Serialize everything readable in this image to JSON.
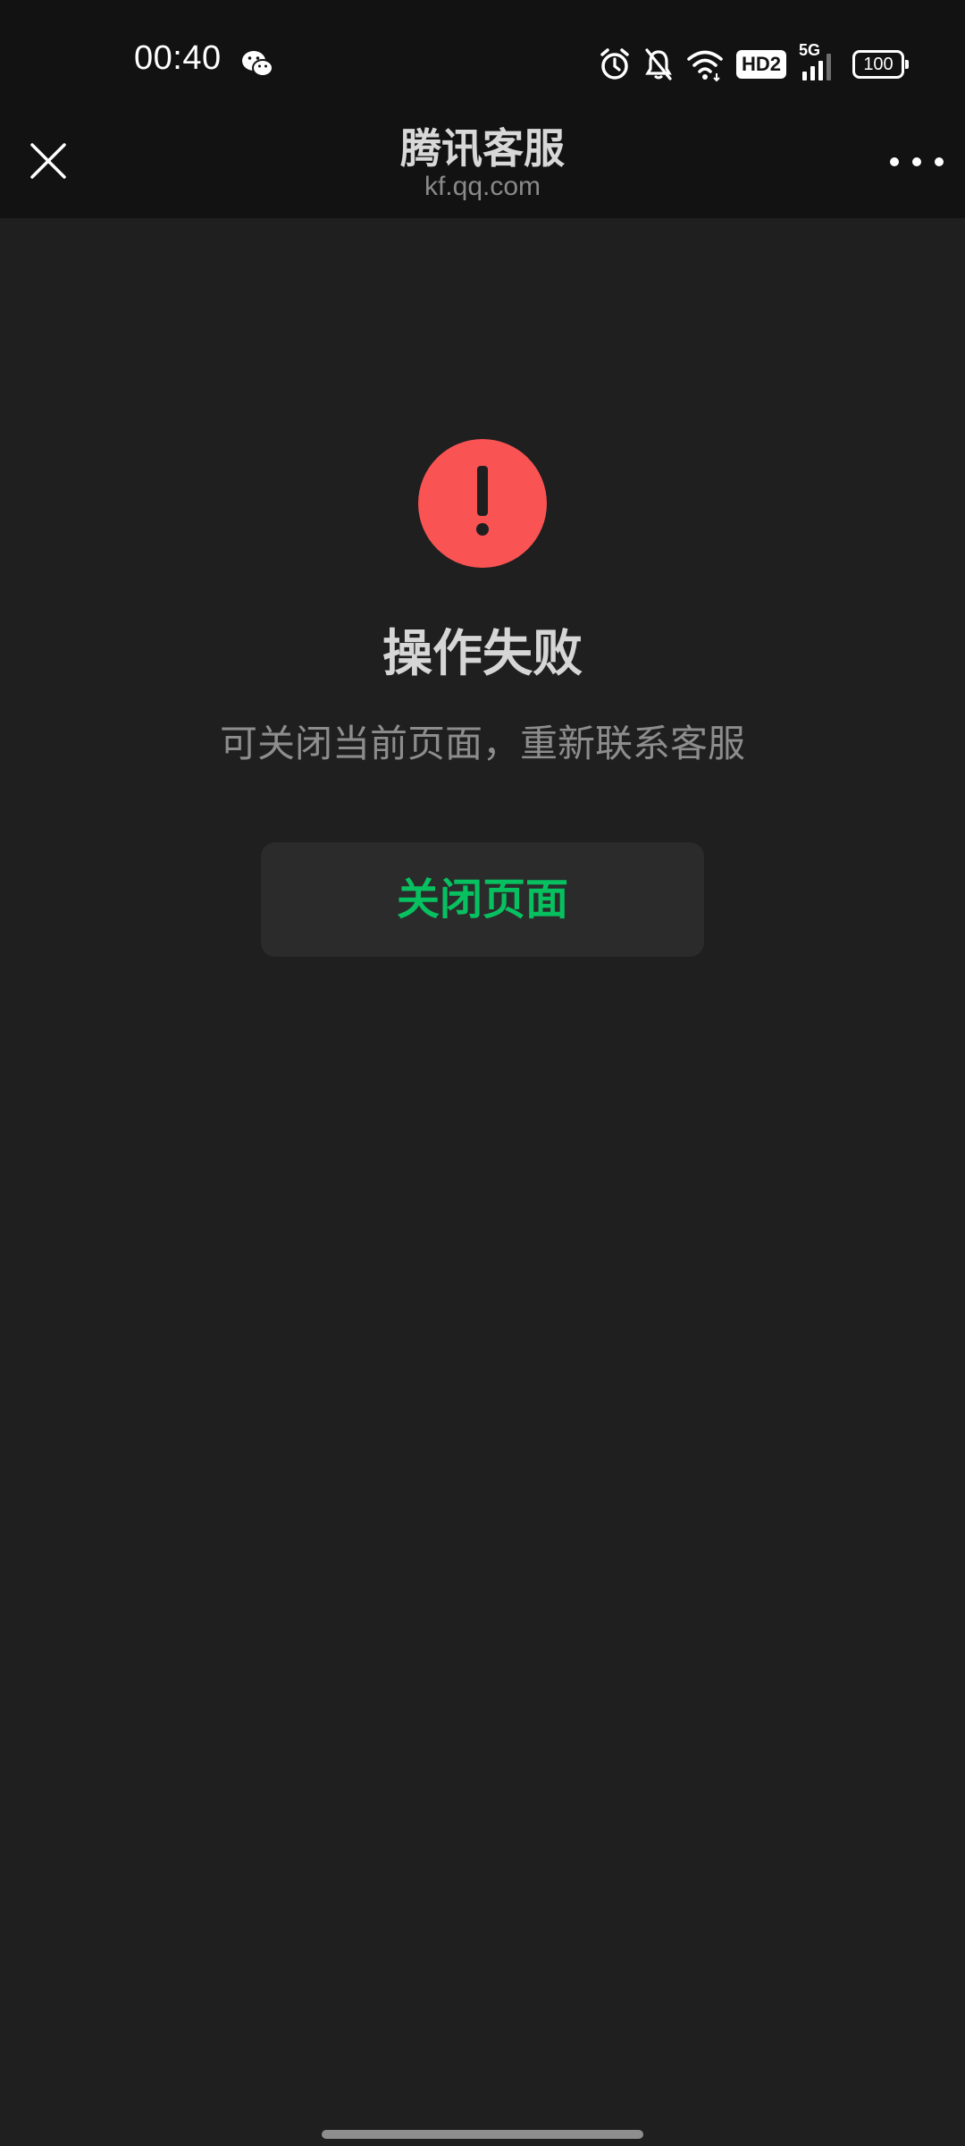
{
  "status_bar": {
    "time": "00:40",
    "hd_label": "HD2",
    "network_label": "5G",
    "battery_level": "100",
    "icons": [
      "wechat-icon",
      "alarm-icon",
      "bell-muted-icon",
      "wifi-icon",
      "hd-icon",
      "signal-icon",
      "battery-icon"
    ]
  },
  "nav": {
    "title": "腾讯客服",
    "subtitle": "kf.qq.com",
    "close_icon": "close-icon",
    "more_icon": "more-icon"
  },
  "result": {
    "icon": "warning-icon",
    "icon_color": "#f95353",
    "title": "操作失败",
    "description": "可关闭当前页面，重新联系客服",
    "button_label": "关闭页面",
    "button_color": "#07c160"
  }
}
